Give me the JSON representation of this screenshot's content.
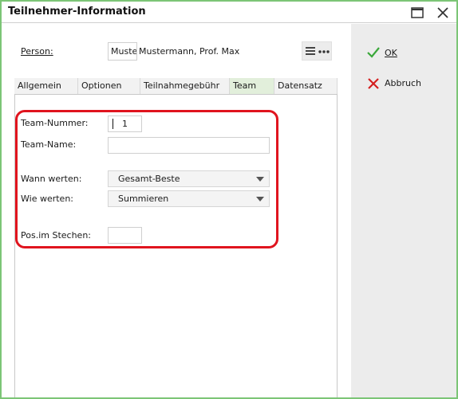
{
  "window": {
    "title": "Teilnehmer-Information"
  },
  "person": {
    "label": "Person:",
    "box_value": "Musterma",
    "name": "Mustermann, Prof. Max"
  },
  "tabs": [
    {
      "label": "Allgemein",
      "active": false
    },
    {
      "label": "Optionen",
      "active": false
    },
    {
      "label": "Teilnahmegebühr",
      "active": false
    },
    {
      "label": "Team",
      "active": true
    },
    {
      "label": "Datensatz",
      "active": false
    }
  ],
  "form": {
    "team_nummer_label": "Team-Nummer:",
    "team_nummer_value": "1",
    "team_name_label": "Team-Name:",
    "team_name_value": "",
    "wann_label": "Wann werten:",
    "wann_value": "Gesamt-Beste",
    "wie_label": "Wie werten:",
    "wie_value": "Summieren",
    "pos_label": "Pos.im Stechen:",
    "pos_value": ""
  },
  "buttons": {
    "ok_label": "OK",
    "cancel_label": "Abbruch"
  },
  "colors": {
    "window_border": "#7cc576",
    "active_tab": "#e2efdb",
    "highlight": "#e0141e",
    "ok_check": "#3aa83a",
    "cancel_x": "#d42020"
  },
  "icons": [
    "maximize-icon",
    "close-icon",
    "hamburger-icon",
    "ellipsis-icon",
    "checkmark-icon",
    "cross-icon"
  ]
}
